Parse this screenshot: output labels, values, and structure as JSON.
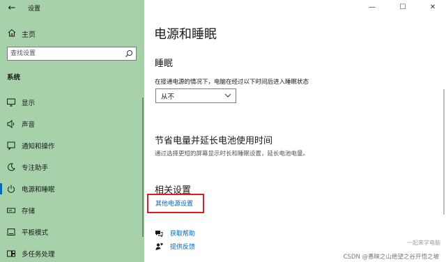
{
  "window": {
    "app_title": "设置",
    "controls": {
      "minimize": "—",
      "maximize": "☐",
      "close": "✕"
    }
  },
  "sidebar": {
    "back_glyph": "←",
    "home_label": "主页",
    "search_placeholder": "查找设置",
    "section_label": "系统",
    "items": [
      {
        "label": "显示",
        "icon": "monitor-icon"
      },
      {
        "label": "声音",
        "icon": "speaker-icon"
      },
      {
        "label": "通知和操作",
        "icon": "notification-icon"
      },
      {
        "label": "专注助手",
        "icon": "moon-icon"
      },
      {
        "label": "电源和睡眠",
        "icon": "power-icon",
        "active": true
      },
      {
        "label": "存储",
        "icon": "storage-icon"
      },
      {
        "label": "平板模式",
        "icon": "tablet-icon"
      },
      {
        "label": "多任务处理",
        "icon": "multitask-icon"
      }
    ]
  },
  "content": {
    "page_title": "电源和睡眠",
    "sleep": {
      "heading": "睡眠",
      "description": "在接通电源的情况下，电脑在经过以下时间后进入睡眠状态",
      "selected": "从不"
    },
    "battery": {
      "heading": "节省电量并延长电池使用时间",
      "description": "通过选择更短的屏幕显示时长和睡眠设置，延长电池电量。"
    },
    "related": {
      "heading": "相关设置",
      "link": "其他电源设置"
    },
    "help": {
      "get_help": "获取帮助",
      "feedback": "提供反馈"
    }
  },
  "watermark": {
    "text": "CSDN @愚昧之山绝望之谷开悟之坡",
    "overlay": "一起来学电脑"
  },
  "colors": {
    "sidebar_bg": "#a7d1a8",
    "accent": "#0067c0",
    "highlight": "#e01b1b"
  }
}
